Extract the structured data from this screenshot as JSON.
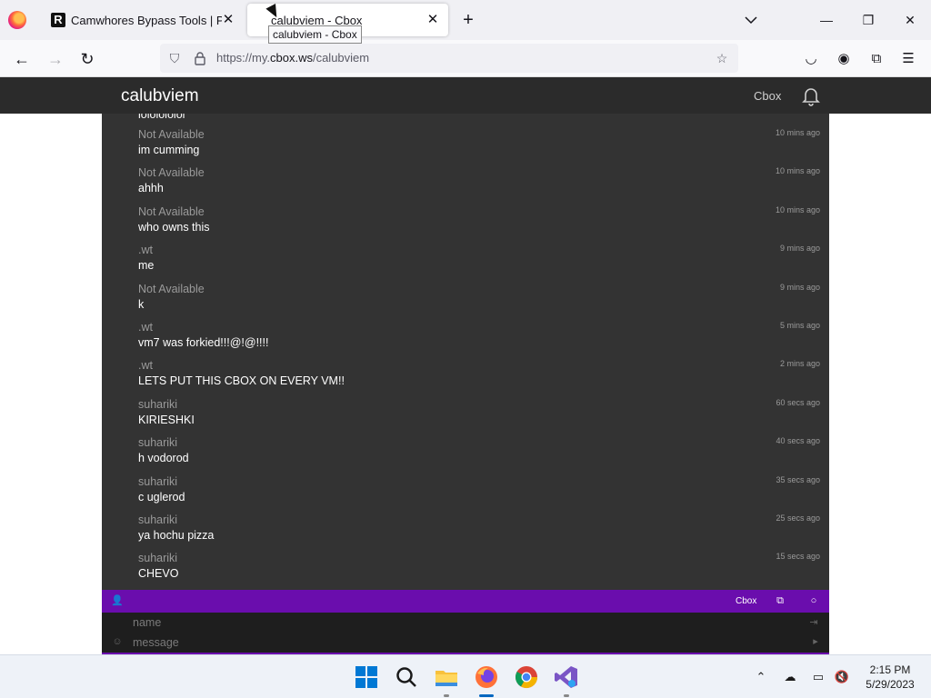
{
  "browser": {
    "tabs": [
      {
        "title": "Camwhores Bypass Tools | Priva",
        "favicon": "R"
      },
      {
        "title": "calubviem - Cbox"
      }
    ],
    "tooltip": "calubviem - Cbox",
    "url_prefix": "https://my.",
    "url_domain": "cbox.ws",
    "url_path": "/calubviem"
  },
  "page": {
    "site_title": "calubviem",
    "header_link": "Cbox",
    "cut_text": "lololololol"
  },
  "messages": [
    {
      "name": "Not Available",
      "text": "im cumming",
      "time": "10 mins ago"
    },
    {
      "name": "Not Available",
      "text": "ahhh",
      "time": "10 mins ago"
    },
    {
      "name": "Not Available",
      "text": "who owns this",
      "time": "10 mins ago"
    },
    {
      "name": ".wt",
      "text": "me",
      "time": "9 mins ago"
    },
    {
      "name": "Not Available",
      "text": "k",
      "time": "9 mins ago"
    },
    {
      "name": ".wt",
      "text": "vm7 was forkied!!!@!@!!!!",
      "time": "5 mins ago"
    },
    {
      "name": ".wt",
      "text": "LETS PUT THIS CBOX ON EVERY VM!!",
      "time": "2 mins ago"
    },
    {
      "name": "suhariki",
      "text": "KIRIESHKI",
      "time": "60 secs ago"
    },
    {
      "name": "suhariki",
      "text": "h vodorod",
      "time": "40 secs ago"
    },
    {
      "name": "suhariki",
      "text": "c uglerod",
      "time": "35 secs ago"
    },
    {
      "name": "suhariki",
      "text": "ya hochu pizza",
      "time": "25 secs ago"
    },
    {
      "name": "suhariki",
      "text": "CHEVO",
      "time": "15 secs ago"
    }
  ],
  "cbox_bar": {
    "label": "Cbox",
    "accent": "#6a0dad"
  },
  "form": {
    "name_placeholder": "name",
    "message_placeholder": "message"
  },
  "taskbar": {
    "time": "2:15 PM",
    "date": "5/29/2023",
    "apps": [
      "windows-start-icon",
      "search-icon",
      "file-explorer-icon",
      "firefox-icon",
      "chrome-icon",
      "visual-studio-icon"
    ]
  }
}
